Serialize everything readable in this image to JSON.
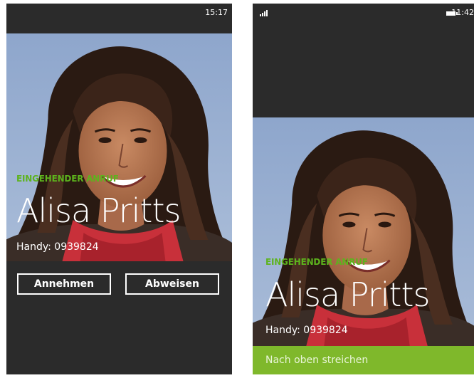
{
  "left_phone": {
    "status": {
      "time": "15:17"
    },
    "call": {
      "label": "EINGEHENDER ANRUF",
      "caller_name": "Alisa Pritts",
      "caller_number": "Handy: 0939824"
    },
    "buttons": {
      "accept": "Annehmen",
      "decline": "Abweisen"
    }
  },
  "right_phone": {
    "status": {
      "time": "11:42",
      "signal_icon": "signal-icon",
      "battery_icon": "battery-icon"
    },
    "call": {
      "label": "EINGEHENDER ANRUF",
      "caller_name": "Alisa Pritts",
      "caller_number": "Handy: 0939824"
    },
    "swipe_hint": "Nach oben streichen"
  },
  "colors": {
    "background": "#2b2b2b",
    "accent_green": "#5db31d",
    "swipe_bar": "#7fb82b",
    "sky": "#8fa6c8"
  }
}
